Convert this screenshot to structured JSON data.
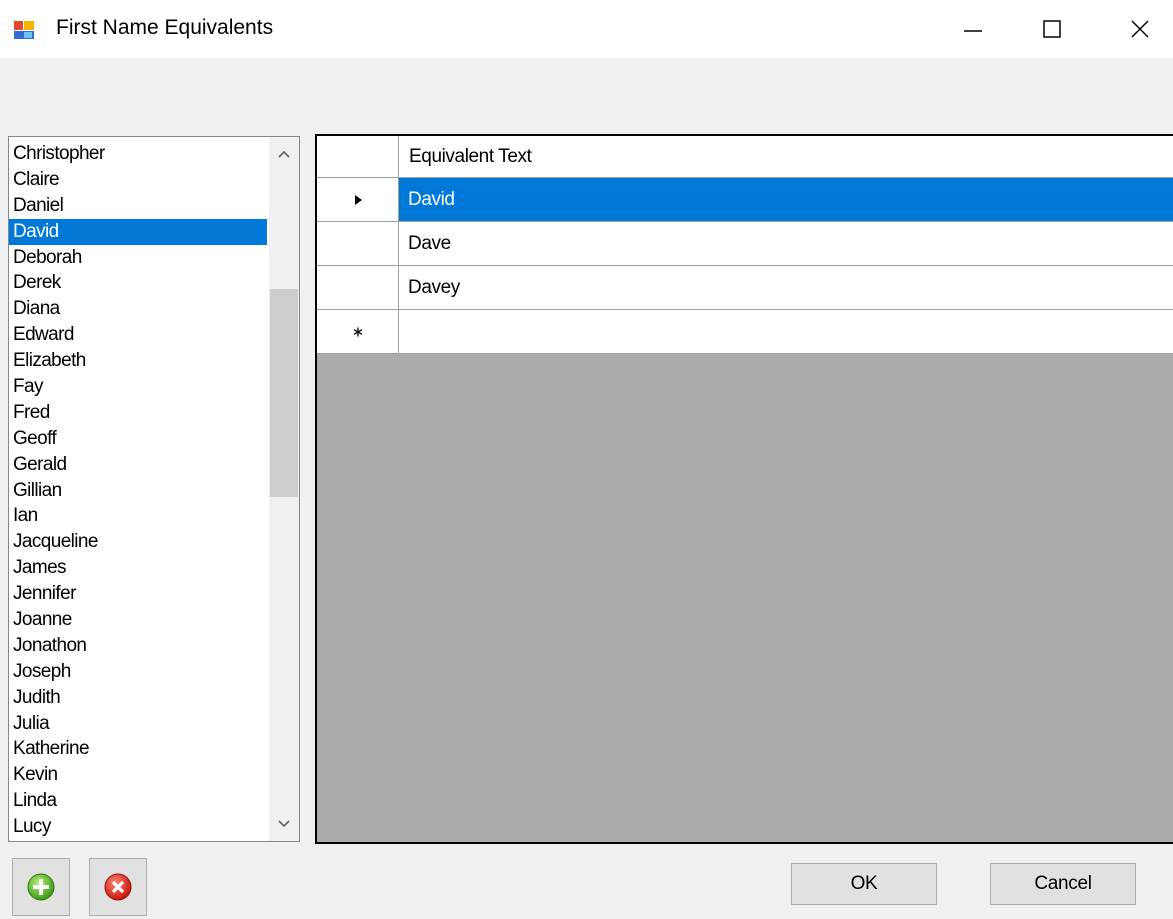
{
  "window": {
    "title": "First Name Equivalents"
  },
  "names_list": {
    "items": [
      "Christopher",
      "Claire",
      "Daniel",
      "David",
      "Deborah",
      "Derek",
      "Diana",
      "Edward",
      "Elizabeth",
      "Fay",
      "Fred",
      "Geoff",
      "Gerald",
      "Gillian",
      "Ian",
      "Jacqueline",
      "James",
      "Jennifer",
      "Joanne",
      "Jonathon",
      "Joseph",
      "Judith",
      "Julia",
      "Katherine",
      "Kevin",
      "Linda",
      "Lucy"
    ],
    "selected": "David"
  },
  "grid": {
    "column_header": "Equivalent Text",
    "rows": [
      "David",
      "Dave",
      "Davey"
    ],
    "selected_row": "David"
  },
  "buttons": {
    "ok": "OK",
    "cancel": "Cancel",
    "add_icon": "add-icon",
    "delete_icon": "delete-icon"
  },
  "colors": {
    "selection": "#0078d7",
    "grid_background": "#ababab",
    "window_background": "#f0f0f0"
  }
}
